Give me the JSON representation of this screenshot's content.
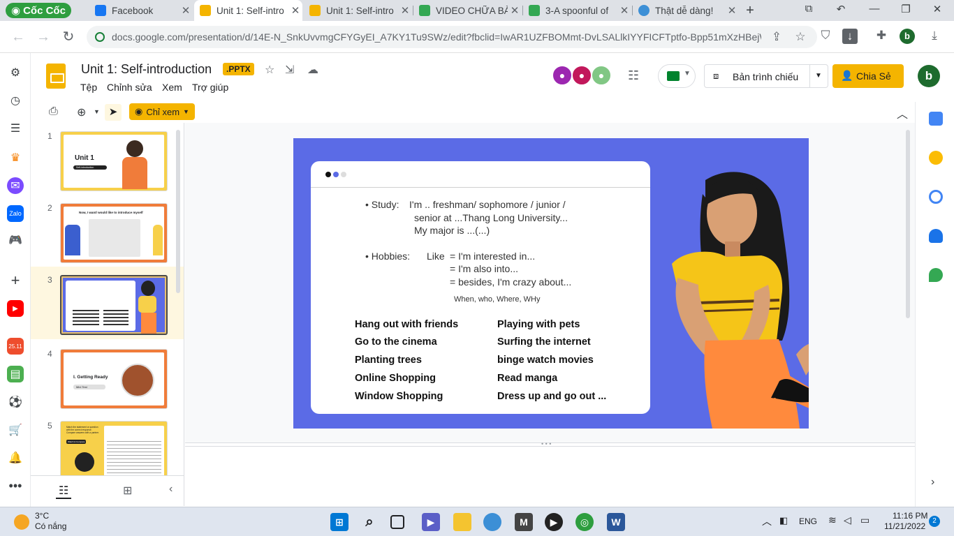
{
  "browser": {
    "brand": "Cốc Cốc",
    "tabs": [
      {
        "title": "Facebook",
        "color": "#1877f2",
        "active": false
      },
      {
        "title": "Unit 1: Self-intro",
        "color": "#f4b400",
        "active": true
      },
      {
        "title": "Unit 1: Self-intro",
        "color": "#f4b400",
        "active": false
      },
      {
        "title": "VIDEO CHỮA BÀ",
        "color": "#34a853",
        "active": false
      },
      {
        "title": "3-A spoonful of",
        "color": "#34a853",
        "active": false
      },
      {
        "title": "Thật dễ dàng!",
        "color": "#3c8fd6",
        "active": false
      }
    ],
    "new_tab_label": "+",
    "url": "docs.google.com/presentation/d/14E-N_SnkUvvmgCFYGyEI_A7KY1Tu9SWz/edit?fbclid=IwAR1UZFBOMmt-DvLSALlkIYYFICFTptfo-Bpp51mXzHBejW03...",
    "profile_initial": "b"
  },
  "docs": {
    "title": "Unit 1: Self-introduction",
    "badge": ".PPTX",
    "menu": [
      "Tệp",
      "Chỉnh sửa",
      "Xem",
      "Trợ giúp"
    ],
    "present_label": "Bản trình chiếu",
    "share_label": "Chia Sẻ",
    "view_only_label": "Chỉ xem",
    "profile_initial": "b"
  },
  "filmstrip": {
    "slides": [
      {
        "num": "1",
        "title": "Unit 1",
        "sub": "Self-introduction"
      },
      {
        "num": "2",
        "title": "Now, I want/ would like to introduce myself"
      },
      {
        "num": "3",
        "title": ""
      },
      {
        "num": "4",
        "title": "I. Getting Ready",
        "sub": "Mini Test"
      },
      {
        "num": "5",
        "title": "Match the statement or question with the correct response. Compare answers with a partner.",
        "sub": "Watch & Compare"
      }
    ]
  },
  "slide": {
    "study_label": "• Study:",
    "study_line1": "I'm .. freshman/ sophomore / junior /",
    "study_line2": "senior at ...Thang Long University...",
    "study_line3": "My major is ...(...)",
    "hobbies_label": "• Hobbies:",
    "like_label": "Like",
    "hobby_line1": "= I'm interested in...",
    "hobby_line2": "= I'm also into...",
    "hobby_line3": "= besides, I'm crazy about...",
    "wh_note": "When, who, Where, WHy",
    "col_left": [
      "Hang out with friends",
      "Go to the cinema",
      "Planting trees",
      "Online Shopping",
      "Window Shopping"
    ],
    "col_right": [
      "Playing with pets",
      "Surfing the internet",
      "binge watch movies",
      "Read manga",
      "Dress up and go out ..."
    ]
  },
  "taskbar": {
    "weather_temp": "3°C",
    "weather_desc": "Có nắng",
    "lang": "ENG",
    "time": "11:16 PM",
    "date": "11/21/2022",
    "notif_count": "2"
  },
  "colors": {
    "slide_bg": "#5b6be6",
    "accent": "#f4b400",
    "coccoc_green": "#2e9e3f"
  }
}
